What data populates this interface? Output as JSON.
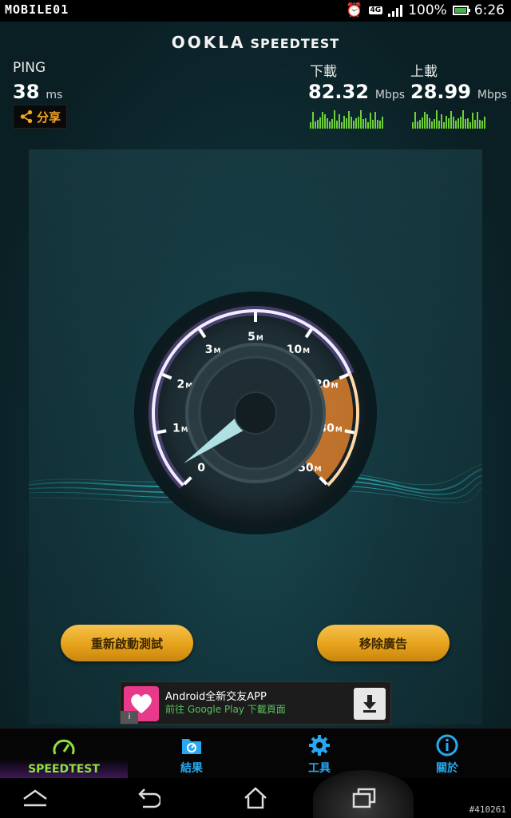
{
  "status_bar": {
    "logo_text": "MOBILE01",
    "network": "4G",
    "battery_percent": "100%",
    "battery_level": 1.0,
    "time": "6:26"
  },
  "app": {
    "brand": "OOKLA",
    "brand_sub": "SPEEDTEST",
    "ping": {
      "label": "PING",
      "value": "38",
      "unit": "ms"
    },
    "download": {
      "label": "下載",
      "value": "82.32",
      "unit": "Mbps"
    },
    "upload": {
      "label": "上載",
      "value": "28.99",
      "unit": "Mbps"
    },
    "share_label": "分享",
    "gauge": {
      "ticks": [
        {
          "num": "0",
          "suffix": ""
        },
        {
          "num": "1",
          "suffix": "M"
        },
        {
          "num": "2",
          "suffix": "M"
        },
        {
          "num": "3",
          "suffix": "M"
        },
        {
          "num": "5",
          "suffix": "M"
        },
        {
          "num": "10",
          "suffix": "M"
        },
        {
          "num": "20",
          "suffix": "M"
        },
        {
          "num": "30",
          "suffix": "M"
        },
        {
          "num": "50",
          "suffix": "M"
        }
      ],
      "needle_value": 0
    },
    "restart_button": "重新啟動測試",
    "remove_ads_button": "移除廣告",
    "ad": {
      "title": "Android全新交友APP",
      "subtitle": "前往 Google Play 下載頁面",
      "info": "i"
    }
  },
  "tabs": [
    {
      "label": "SPEEDTEST",
      "icon": "speedometer-icon",
      "active": true
    },
    {
      "label": "結果",
      "icon": "results-folder-icon",
      "active": false
    },
    {
      "label": "工具",
      "icon": "gear-icon",
      "active": false
    },
    {
      "label": "關於",
      "icon": "info-icon",
      "active": false
    }
  ],
  "nav": {
    "buttons": [
      "menu-up-icon",
      "back-icon",
      "home-icon",
      "recent-apps-icon"
    ]
  },
  "watermark": "#410261",
  "colors": {
    "accent_orange": "#f5a623",
    "graph_green": "#6fcf3a",
    "tab_active": "#8fe23c",
    "tab_normal": "#29a8ef",
    "gauge_purple": "#a67cf0",
    "gauge_orange": "#e8842a"
  }
}
